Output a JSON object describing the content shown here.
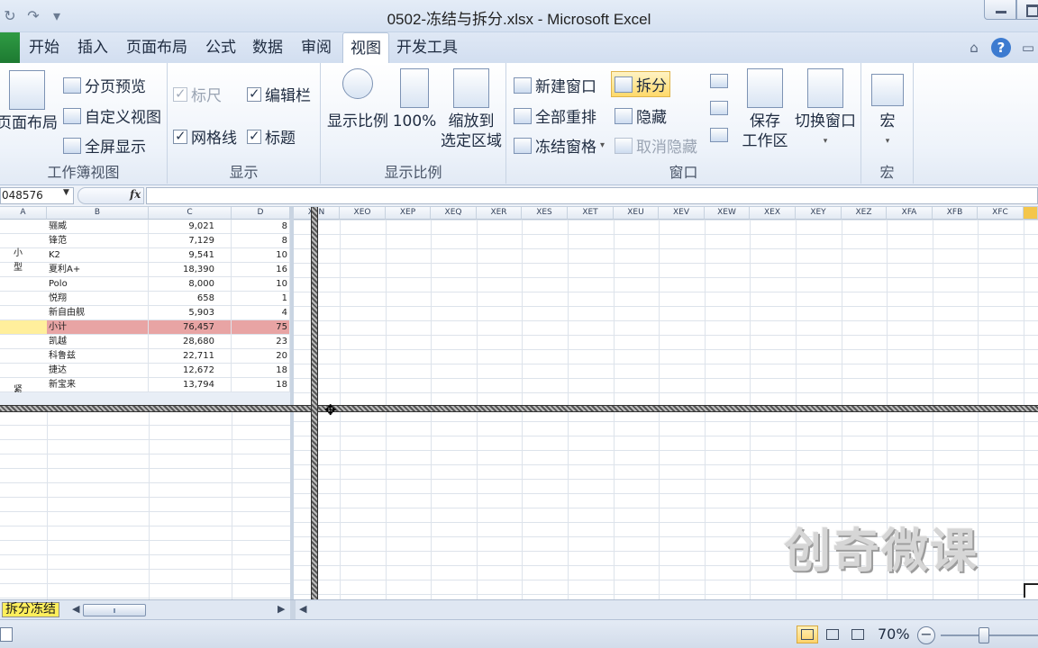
{
  "window": {
    "title": "0502-冻结与拆分.xlsx - Microsoft Excel"
  },
  "ribbon_tabs": [
    {
      "label": "开始"
    },
    {
      "label": "插入"
    },
    {
      "label": "页面布局"
    },
    {
      "label": "公式"
    },
    {
      "label": "数据"
    },
    {
      "label": "审阅"
    },
    {
      "label": "视图",
      "active": true
    },
    {
      "label": "开发工具"
    }
  ],
  "ribbon": {
    "workbook_views": {
      "label": "工作簿视图",
      "page_layout": "页面布局",
      "page_break_preview": "分页预览",
      "custom_views": "自定义视图",
      "full_screen": "全屏显示"
    },
    "show": {
      "label": "显示",
      "ruler": "标尺",
      "formula_bar": "编辑栏",
      "gridlines": "网格线",
      "headings": "标题"
    },
    "zoom": {
      "label": "显示比例",
      "zoom": "显示比例",
      "hundred": "100%",
      "zoom_to_selection_1": "缩放到",
      "zoom_to_selection_2": "选定区域"
    },
    "window": {
      "label": "窗口",
      "new_window": "新建窗口",
      "arrange_all": "全部重排",
      "freeze_panes": "冻结窗格",
      "split": "拆分",
      "hide": "隐藏",
      "unhide": "取消隐藏",
      "save_workspace_1": "保存",
      "save_workspace_2": "工作区",
      "switch_windows": "切换窗口"
    },
    "macros": {
      "label": "宏",
      "macros": "宏"
    }
  },
  "formula_bar": {
    "name_box": "048576",
    "fx": "fx",
    "value": ""
  },
  "columns_left": [
    "A",
    "B",
    "C",
    "D"
  ],
  "columns_right": [
    "XEN",
    "XEO",
    "XEP",
    "XEQ",
    "XER",
    "XES",
    "XET",
    "XEU",
    "XEV",
    "XEW",
    "XEX",
    "XEY",
    "XEZ",
    "XFA",
    "XFB",
    "XFC"
  ],
  "group_labels": {
    "small_1": "小",
    "small_2": "型",
    "compact": "紧"
  },
  "rows": [
    {
      "b": "骊威",
      "c": "9,021",
      "d": "8"
    },
    {
      "b": "锋范",
      "c": "7,129",
      "d": "8"
    },
    {
      "b": "K2",
      "c": "9,541",
      "d": "10"
    },
    {
      "b": "夏利A+",
      "c": "18,390",
      "d": "16"
    },
    {
      "b": "Polo",
      "c": "8,000",
      "d": "10"
    },
    {
      "b": "悦翔",
      "c": "658",
      "d": "1"
    },
    {
      "b": "新自由舰",
      "c": "5,903",
      "d": "4"
    },
    {
      "b": "小计",
      "c": "76,457",
      "d": "75",
      "subtotal": true
    },
    {
      "b": "凯越",
      "c": "28,680",
      "d": "23"
    },
    {
      "b": "科鲁兹",
      "c": "22,711",
      "d": "20"
    },
    {
      "b": "捷达",
      "c": "12,672",
      "d": "18"
    },
    {
      "b": "新宝来",
      "c": "13,794",
      "d": "18"
    }
  ],
  "watermark": "创奇微课",
  "sheet_tab": "拆分冻结",
  "status": {
    "zoom": "70%"
  },
  "colors": {
    "subtotal_fill": "#e8a4a4",
    "active_cell_fill": "#ffef9c",
    "sheet_tab_fill": "#ffef5c",
    "file_tab": "#2f9b44"
  }
}
